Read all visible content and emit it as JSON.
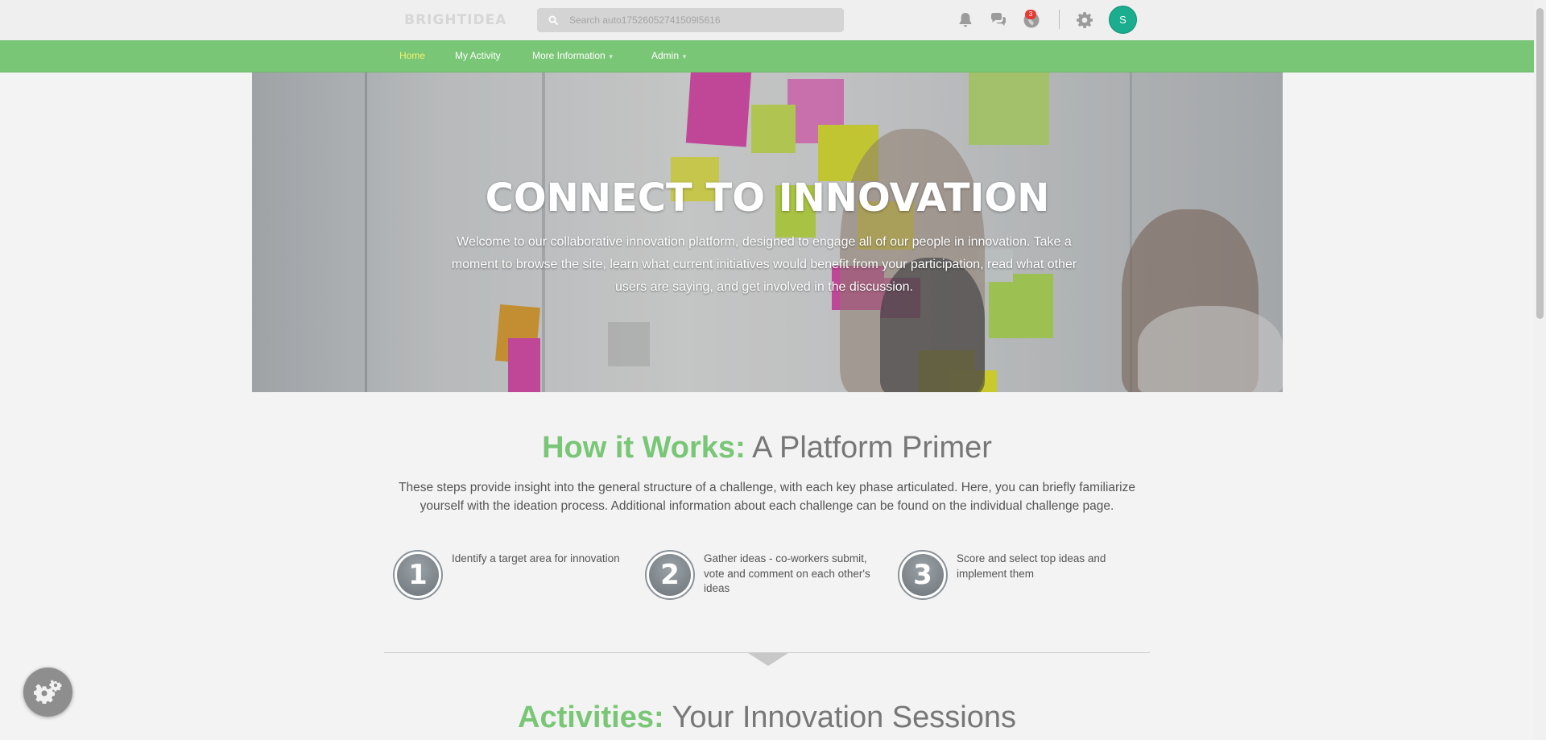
{
  "header": {
    "logo_text": "BRIGHTIDEA",
    "search": {
      "placeholder": "Search auto17526052741509l5616",
      "value": ""
    },
    "icons": [
      "bell-icon",
      "chat-icon",
      "notification-globe-icon",
      "gear-icon"
    ],
    "notification_count": "3",
    "avatar_initial": "S"
  },
  "nav": {
    "items": [
      {
        "label": "Home",
        "active": true
      },
      {
        "label": "My Activity"
      },
      {
        "label": "More Information",
        "dropdown": true
      },
      {
        "label": "Admin",
        "dropdown": true
      }
    ]
  },
  "hero": {
    "title": "CONNECT TO INNOVATION",
    "text": "Welcome to our collaborative innovation platform, designed to engage all of our people in innovation. Take a moment to browse the site, learn what current initiatives would benefit from your participation, read what other users are saying, and get involved in the discussion."
  },
  "how_it_works": {
    "title_highlight": "How it Works:",
    "title_rest": " A Platform Primer",
    "description": "These steps provide insight into the general structure of a challenge, with each key phase articulated. Here, you can briefly familiarize yourself with the ideation process. Additional information about each challenge can be found on the individual challenge page.",
    "steps": [
      {
        "number": "1",
        "text": "Identify a target area for innovation"
      },
      {
        "number": "2",
        "text": "Gather ideas - co-workers submit, vote and comment on each other's ideas"
      },
      {
        "number": "3",
        "text": "Score and select top ideas and implement them"
      }
    ]
  },
  "activities": {
    "title_highlight": "Activities:",
    "title_rest": " Your Innovation Sessions"
  },
  "colors": {
    "brand_green": "#79c676",
    "active_nav": "#f4f26b",
    "avatar": "#1aad8e",
    "badge": "#e53935"
  }
}
